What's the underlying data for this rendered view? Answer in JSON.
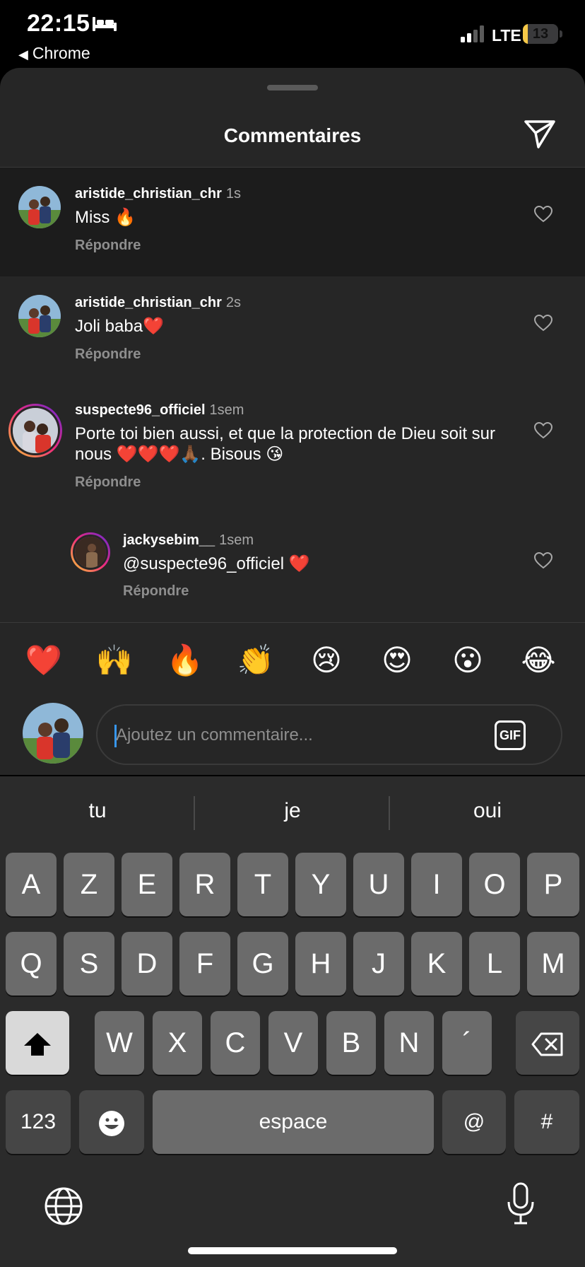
{
  "status_bar": {
    "time": "22:15",
    "back_app": "Chrome",
    "network": "LTE",
    "battery_level": "13",
    "battery_fraction": 0.13,
    "battery_color": "#f7c948",
    "icons": [
      "bed-icon",
      "signal-icon"
    ]
  },
  "sheet": {
    "title": "Commentaires",
    "share_icon": "paper-plane-icon"
  },
  "comments": [
    {
      "username": "aristide_christian_chr",
      "time": "1s",
      "text": "Miss 🔥",
      "reply": "Répondre",
      "highlighted": true
    },
    {
      "username": "aristide_christian_chr",
      "time": "2s",
      "text": "Joli baba❤️",
      "reply": "Répondre",
      "highlighted": false
    },
    {
      "username": "suspecte96_officiel",
      "time": "1sem",
      "text": "Porte toi bien aussi, et que la protection de Dieu soit sur nous ❤️❤️❤️🙏🏾. Bisous 😘",
      "reply": "Répondre",
      "highlighted": false
    },
    {
      "username": "jackysebim__",
      "time": "1sem",
      "text": "@suspecte96_officiel ❤️",
      "reply": "Répondre",
      "highlighted": false,
      "is_reply": true
    }
  ],
  "emoji_bar": [
    "❤️",
    "🙌",
    "🔥",
    "👏",
    "😢",
    "😍",
    "😮",
    "😂"
  ],
  "composer": {
    "placeholder": "Ajoutez un commentaire...",
    "gif_label": "GIF"
  },
  "keyboard": {
    "suggestions": [
      "tu",
      "je",
      "oui"
    ],
    "row1": [
      "A",
      "Z",
      "E",
      "R",
      "T",
      "Y",
      "U",
      "I",
      "O",
      "P"
    ],
    "row2": [
      "Q",
      "S",
      "D",
      "F",
      "G",
      "H",
      "J",
      "K",
      "L",
      "M"
    ],
    "row3": [
      "W",
      "X",
      "C",
      "V",
      "B",
      "N",
      "´"
    ],
    "numbers_label": "123",
    "space_label": "espace",
    "at_label": "@",
    "hash_label": "#"
  }
}
